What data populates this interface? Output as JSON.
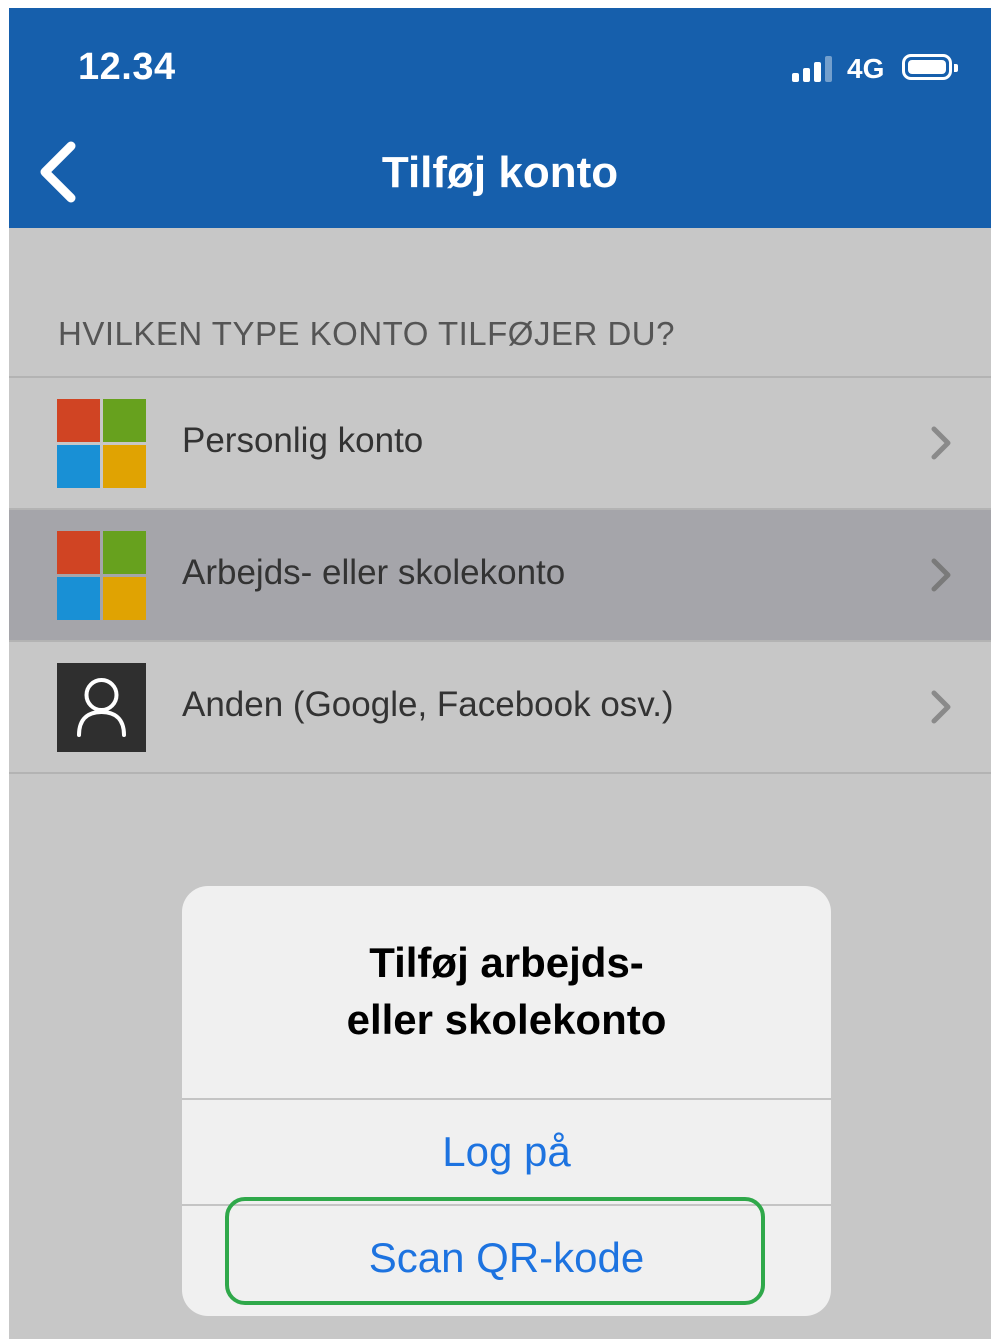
{
  "status_bar": {
    "time": "12.34",
    "network": "4G",
    "icons": [
      "signal-icon",
      "battery-icon"
    ]
  },
  "nav": {
    "title": "Tilføj konto",
    "back_icon": "chevron-left-icon"
  },
  "section_header": "HVILKEN TYPE KONTO TILFØJER DU?",
  "accounts": [
    {
      "label": "Personlig konto",
      "icon": "microsoft-logo-icon"
    },
    {
      "label": "Arbejds- eller skolekonto",
      "icon": "microsoft-logo-icon",
      "selected": true
    },
    {
      "label": "Anden (Google, Facebook osv.)",
      "icon": "person-icon"
    }
  ],
  "alert": {
    "title_line1": "Tilføj arbejds-",
    "title_line2": "eller skolekonto",
    "sign_in_label": "Log på",
    "scan_label": "Scan QR-kode"
  },
  "colors": {
    "header_blue": "#165fac",
    "background_gray": "#c7c7c7",
    "selected_row": "#a5a5aa",
    "alert_button_blue": "#1d73e0",
    "highlight_green": "#2fa84a",
    "ms_red": "#d04423",
    "ms_green": "#67a11e",
    "ms_blue": "#1990d5",
    "ms_yellow": "#e0a302"
  }
}
